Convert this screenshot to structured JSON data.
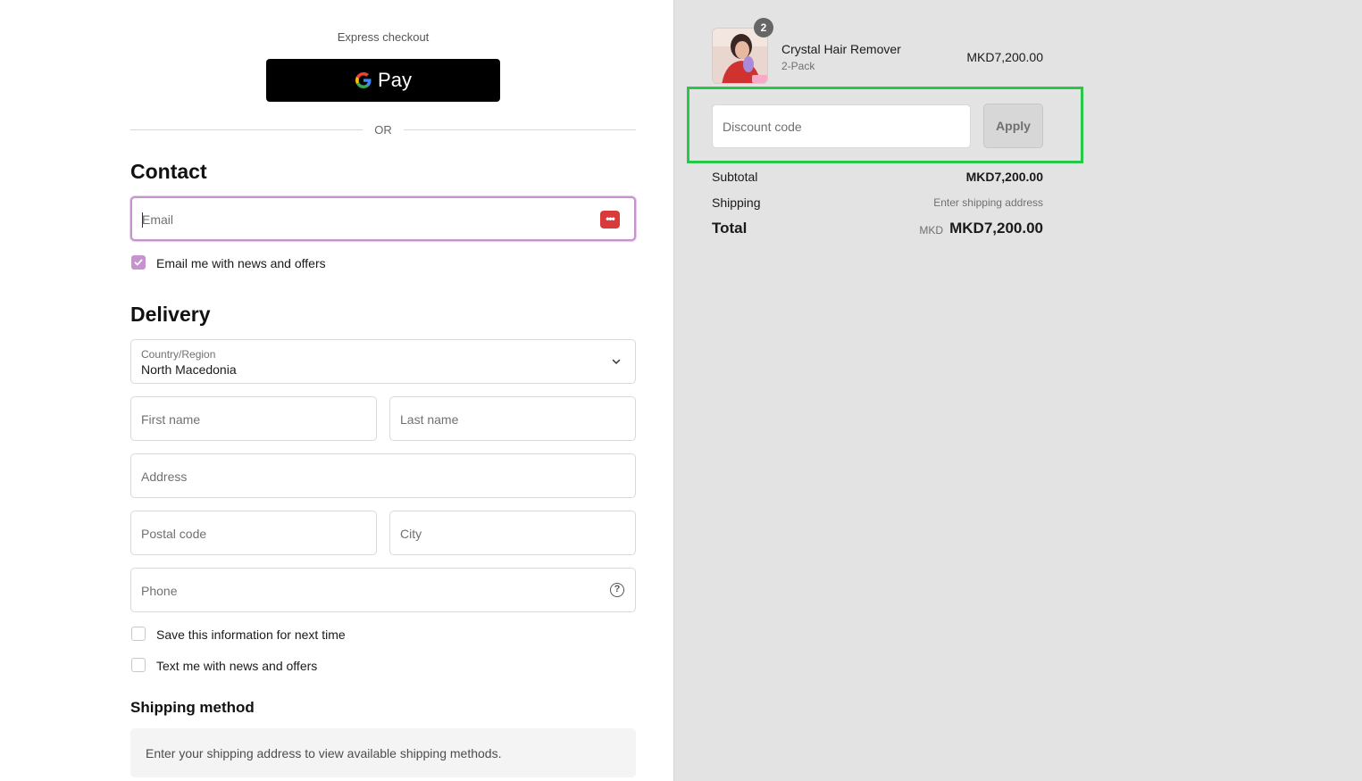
{
  "express": {
    "label": "Express checkout",
    "gpay_label": "Pay"
  },
  "or_text": "OR",
  "contact": {
    "heading": "Contact",
    "email_placeholder": "Email",
    "newsletter_label": "Email me with news and offers",
    "newsletter_checked": true
  },
  "delivery": {
    "heading": "Delivery",
    "country_label": "Country/Region",
    "country_value": "North Macedonia",
    "first_name": "First name",
    "last_name": "Last name",
    "address": "Address",
    "postal_code": "Postal code",
    "city": "City",
    "phone": "Phone",
    "save_info_label": "Save this information for next time",
    "text_offers_label": "Text me with news and offers"
  },
  "shipping_method": {
    "heading": "Shipping method",
    "message": "Enter your shipping address to view available shipping methods."
  },
  "summary": {
    "product": {
      "quantity": "2",
      "name": "Crystal Hair Remover",
      "variant": "2-Pack",
      "price": "MKD7,200.00"
    },
    "discount_placeholder": "Discount code",
    "apply_label": "Apply",
    "subtotal_label": "Subtotal",
    "subtotal_value": "MKD7,200.00",
    "shipping_label": "Shipping",
    "shipping_value": "Enter shipping address",
    "total_label": "Total",
    "total_currency": "MKD",
    "total_value": "MKD7,200.00"
  },
  "colors": {
    "accent": "#c792cf",
    "highlight": "#27c84a",
    "summary_bg": "#e3e3e3"
  }
}
